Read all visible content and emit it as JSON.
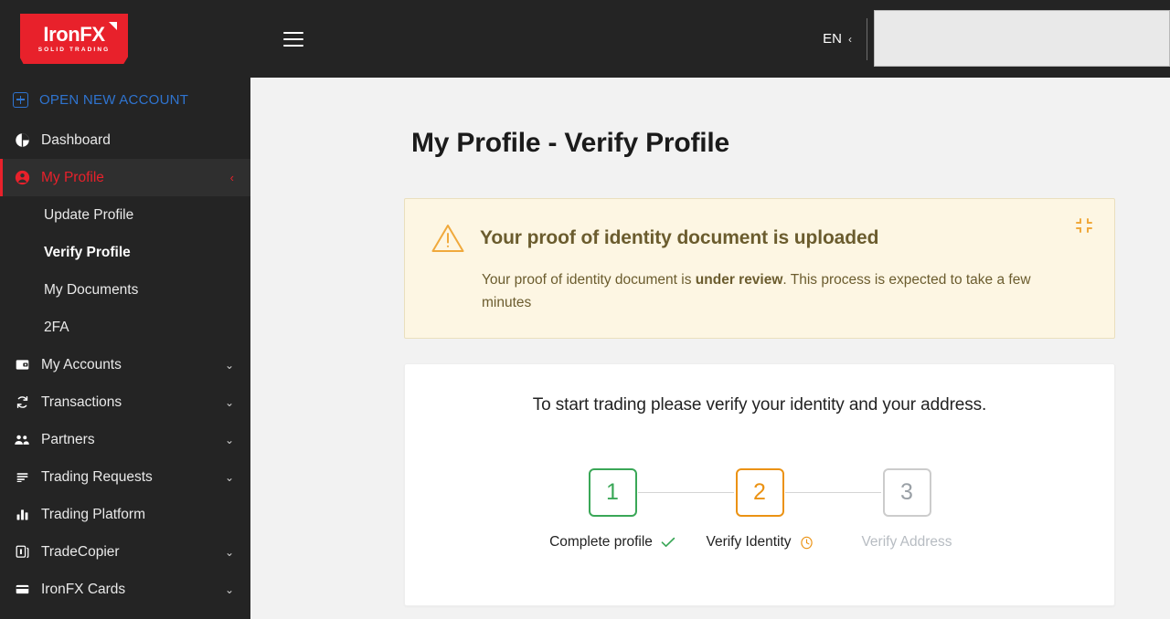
{
  "brand": {
    "logo_main": "IronFX",
    "logo_sub": "SOLID TRADING",
    "accent_red": "#e8212b",
    "accent_blue": "#2f74d0",
    "accent_orange": "#eb9213",
    "accent_green": "#3aa757"
  },
  "sidebar": {
    "open_account_label": "OPEN NEW ACCOUNT",
    "open_account_icon": "plus-box-icon",
    "items": [
      {
        "label": "Dashboard",
        "icon": "pie-chart-icon",
        "caret": "",
        "state": "normal"
      },
      {
        "label": "My Profile",
        "icon": "user-circle-icon",
        "caret": "‹",
        "state": "active"
      },
      {
        "label": "My Accounts",
        "icon": "wallet-icon",
        "caret": "⌄",
        "state": "normal"
      },
      {
        "label": "Transactions",
        "icon": "refresh-cycle-icon",
        "caret": "⌄",
        "state": "normal"
      },
      {
        "label": "Partners",
        "icon": "people-group-icon",
        "caret": "⌄",
        "state": "normal"
      },
      {
        "label": "Trading Requests",
        "icon": "list-lines-icon",
        "caret": "⌄",
        "state": "normal"
      },
      {
        "label": "Trading Platform",
        "icon": "bar-chart-icon",
        "caret": "",
        "state": "normal"
      },
      {
        "label": "TradeCopier",
        "icon": "copy-stack-icon",
        "caret": "⌄",
        "state": "normal"
      },
      {
        "label": "IronFX Cards",
        "icon": "credit-card-icon",
        "caret": "⌄",
        "state": "normal"
      }
    ],
    "submenu": [
      {
        "label": "Update Profile",
        "current": false
      },
      {
        "label": "Verify Profile",
        "current": true
      },
      {
        "label": "My Documents",
        "current": false
      },
      {
        "label": "2FA",
        "current": false
      }
    ]
  },
  "topbar": {
    "menu_icon": "hamburger-icon",
    "language": "EN",
    "language_caret": "‹"
  },
  "main": {
    "page_title": "My Profile - Verify Profile",
    "alert": {
      "icon": "warning-triangle-icon",
      "title": "Your proof of identity document is uploaded",
      "body_before": "Your proof of identity document is ",
      "body_bold": "under review",
      "body_after": ". This process is expected to take a few minutes",
      "collapse_icon": "collapse-inward-icon"
    },
    "card": {
      "lead": "To start trading please verify your identity and your address.",
      "steps": [
        {
          "number": "1",
          "label": "Complete profile",
          "status": "done",
          "status_icon": "check-icon"
        },
        {
          "number": "2",
          "label": "Verify Identity",
          "status": "current",
          "status_icon": "clock-icon"
        },
        {
          "number": "3",
          "label": "Verify Address",
          "status": "pending",
          "status_icon": ""
        }
      ]
    }
  }
}
